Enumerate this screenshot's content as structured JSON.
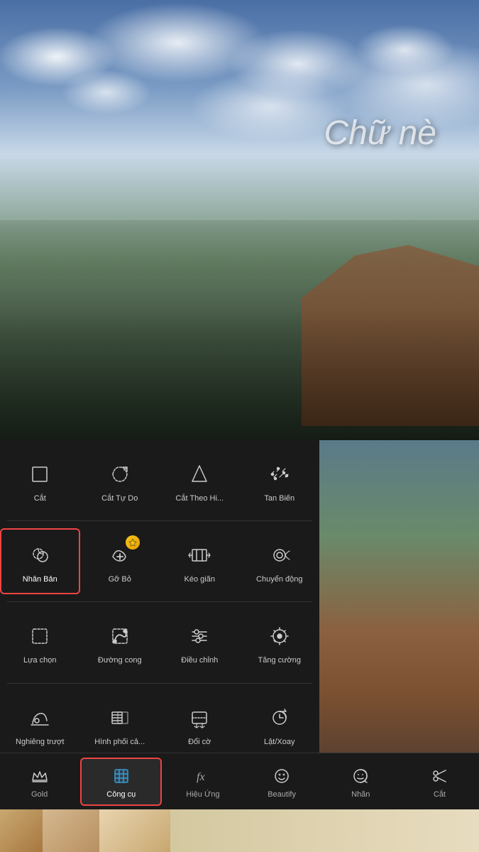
{
  "photo": {
    "overlay_text": "Chữ nè"
  },
  "tools": {
    "rows": [
      [
        {
          "id": "cat",
          "label": "Cắt",
          "icon": "crop"
        },
        {
          "id": "cat-tu-do",
          "label": "Cắt Tự Do",
          "icon": "freehand-crop"
        },
        {
          "id": "cat-theo-hi",
          "label": "Cắt Theo Hi...",
          "icon": "shape-crop"
        },
        {
          "id": "tan-bien",
          "label": "Tan Biến",
          "icon": "dissolve"
        }
      ],
      [
        {
          "id": "nhan-ban",
          "label": "Nhân Bản",
          "icon": "clone",
          "selected": true
        },
        {
          "id": "go-bo",
          "label": "Gỡ Bỏ",
          "icon": "remove",
          "gold": true
        },
        {
          "id": "keo-gian",
          "label": "Kéo giãn",
          "icon": "stretch"
        },
        {
          "id": "chuyen-dong",
          "label": "Chuyển động",
          "icon": "motion"
        }
      ],
      [
        {
          "id": "lua-chon",
          "label": "Lựa chọn",
          "icon": "select"
        },
        {
          "id": "duong-cong",
          "label": "Đường cong",
          "icon": "curve"
        },
        {
          "id": "dieu-chinh",
          "label": "Điều chỉnh",
          "icon": "adjust"
        },
        {
          "id": "tang-cuong",
          "label": "Tăng cường",
          "icon": "enhance"
        }
      ],
      [
        {
          "id": "nghieng-truot",
          "label": "Nghiêng trượt",
          "icon": "tilt"
        },
        {
          "id": "hinh-phoi-ca",
          "label": "Hình phối cả...",
          "icon": "blend"
        },
        {
          "id": "doi-co",
          "label": "Đổi cờ",
          "icon": "swap"
        },
        {
          "id": "lat-xoay",
          "label": "Lật/Xoay",
          "icon": "flip-rotate"
        }
      ]
    ]
  },
  "bottom_nav": [
    {
      "id": "gold",
      "label": "Gold",
      "icon": "crown"
    },
    {
      "id": "cong-cu",
      "label": "Công cụ",
      "icon": "crop-tool",
      "active": true
    },
    {
      "id": "hieu-ung",
      "label": "Hiệu Ứng",
      "icon": "fx"
    },
    {
      "id": "beautify",
      "label": "Beautify",
      "icon": "face"
    },
    {
      "id": "nhan",
      "label": "Nhãn",
      "icon": "sticker"
    },
    {
      "id": "cat-nav",
      "label": "Cắt",
      "icon": "scissors"
    }
  ],
  "colors": {
    "selected_border": "#e44444",
    "active_nav": "#3a9ad9",
    "dark_bg": "#1a1a1a",
    "text_primary": "#cccccc",
    "gold": "#f5c518"
  }
}
